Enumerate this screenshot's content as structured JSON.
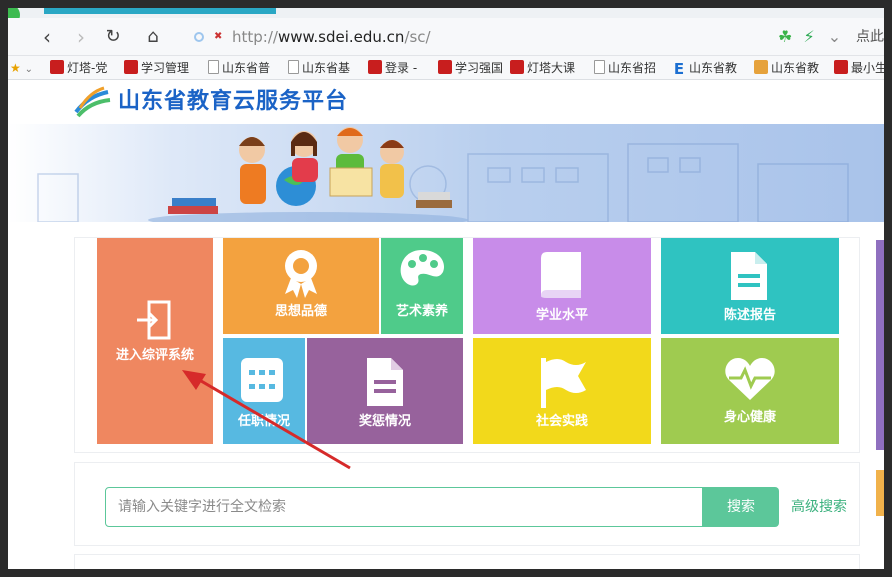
{
  "browser": {
    "url_prefix": "http://",
    "url_host": "www.sdei.edu.cn",
    "url_path": "/sc/",
    "right_text": "点此",
    "bookmarks": [
      "灯塔-党",
      "学习管理",
      "山东省普",
      "山东省基",
      "登录 -",
      "学习强国",
      "灯塔大课",
      "山东省招",
      "山东省教",
      "山东省教",
      "最小生"
    ]
  },
  "site": {
    "title": "山东省教育云服务平台"
  },
  "tiles": {
    "enter": "进入综评系统",
    "moral": "思想品德",
    "art": "艺术素养",
    "academic": "学业水平",
    "report": "陈述报告",
    "duty": "任职情况",
    "reward": "奖惩情况",
    "practice": "社会实践",
    "health": "身心健康"
  },
  "search": {
    "placeholder": "请输入关键字进行全文检索",
    "button": "搜索",
    "advanced": "高级搜索"
  },
  "colors": {
    "enter": "#ef8760",
    "moral": "#f3a23f",
    "art": "#4fcb8a",
    "academic": "#c88ce9",
    "report": "#2fc3c1",
    "duty": "#57b9e1",
    "reward": "#97629c",
    "practice": "#f2d91b",
    "health": "#9fcb50"
  }
}
